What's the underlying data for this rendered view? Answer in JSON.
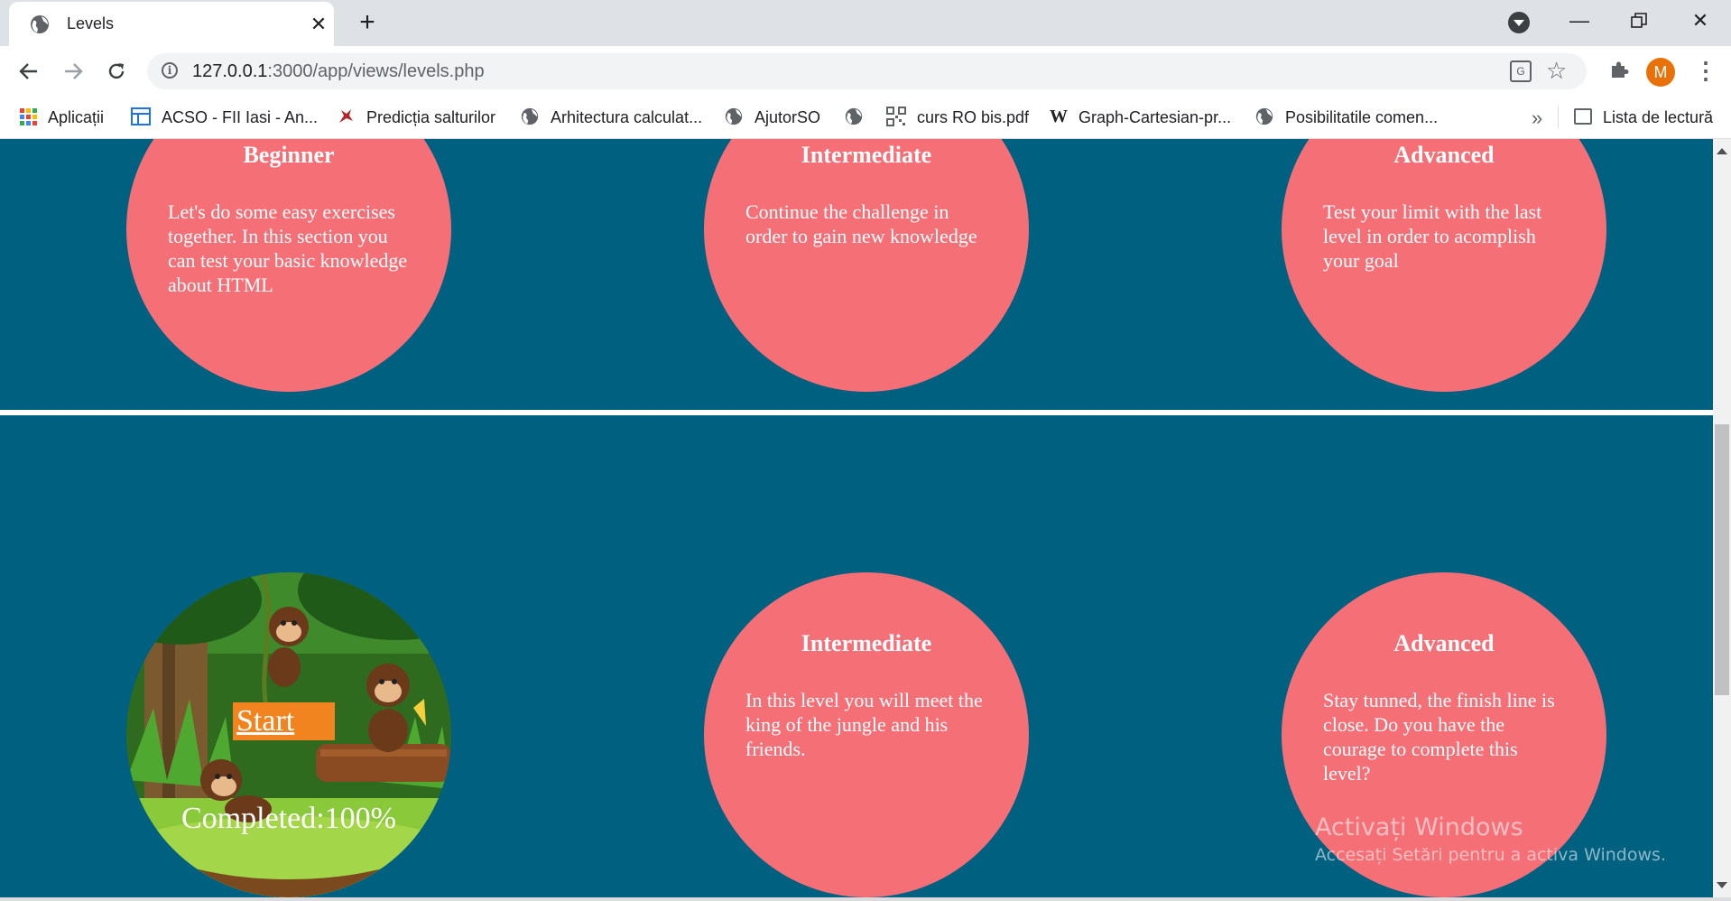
{
  "browser": {
    "tab_title": "Levels",
    "url_host": "127.0.0.1",
    "url_rest": ":3000/app/views/levels.php",
    "avatar_letter": "M",
    "bookmarks": [
      {
        "label": "Aplicații",
        "icon": "apps-grid-icon"
      },
      {
        "label": "ACSO - FII Iasi - An...",
        "icon": "layout-icon"
      },
      {
        "label": "Predicția salturilor",
        "icon": "bird-icon"
      },
      {
        "label": "Arhitectura calculat...",
        "icon": "globe-icon"
      },
      {
        "label": "AjutorSO",
        "icon": "globe-icon"
      },
      {
        "label": "",
        "icon": "globe-icon"
      },
      {
        "label": "curs RO bis.pdf",
        "icon": "qr-icon"
      },
      {
        "label": "Graph-Cartesian-pr...",
        "icon": "wikipedia-icon"
      },
      {
        "label": "Posibilitatile comen...",
        "icon": "globe-icon"
      }
    ],
    "more_bookmarks": "»",
    "reading_list": "Lista de lectură"
  },
  "colors": {
    "page_bg": "#006080",
    "circle": "#f56f77",
    "start_button": "#f28420"
  },
  "levels_row1": [
    {
      "title": "Beginner",
      "text": "Let's do some easy exercises together. In this section you can test your basic knowledge about HTML"
    },
    {
      "title": "Intermediate",
      "text": "Continue the challenge in order to gain new knowledge"
    },
    {
      "title": "Advanced",
      "text": "Test your limit with the last level in order to acomplish your goal"
    }
  ],
  "levels_row2": {
    "start_label": "Start",
    "completed_label": "Completed:100%",
    "completed_progress": 100,
    "cards": [
      {
        "title": "Intermediate",
        "text": "In this level you will meet the king of the jungle and his friends."
      },
      {
        "title": "Advanced",
        "text": "Stay tunned, the finish line is close. Do you have the courage to complete this level?"
      }
    ]
  },
  "watermark": {
    "title": "Activați Windows",
    "subtitle": "Accesați Setări pentru a activa Windows."
  }
}
